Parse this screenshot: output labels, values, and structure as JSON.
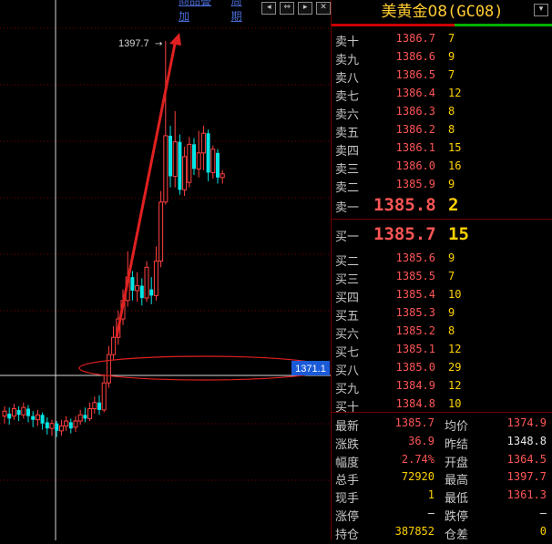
{
  "toolbar": {
    "overlay": "商品叠加",
    "period": "周期"
  },
  "chart": {
    "peak_label": "1397.7",
    "price_tag": "1371.1",
    "candles": [
      {
        "o": 1367.2,
        "c": 1367.6,
        "h": 1368.0,
        "l": 1366.6
      },
      {
        "o": 1367.4,
        "c": 1367.0,
        "h": 1367.9,
        "l": 1366.5
      },
      {
        "o": 1367.2,
        "c": 1367.8,
        "h": 1368.2,
        "l": 1366.9
      },
      {
        "o": 1367.7,
        "c": 1367.3,
        "h": 1368.0,
        "l": 1366.8
      },
      {
        "o": 1367.3,
        "c": 1367.9,
        "h": 1368.3,
        "l": 1367.0
      },
      {
        "o": 1367.8,
        "c": 1367.2,
        "h": 1368.1,
        "l": 1366.7
      },
      {
        "o": 1367.2,
        "c": 1366.9,
        "h": 1367.6,
        "l": 1366.3
      },
      {
        "o": 1366.9,
        "c": 1367.3,
        "h": 1367.7,
        "l": 1366.4
      },
      {
        "o": 1367.3,
        "c": 1366.6,
        "h": 1367.5,
        "l": 1366.1
      },
      {
        "o": 1366.7,
        "c": 1366.2,
        "h": 1367.1,
        "l": 1365.7
      },
      {
        "o": 1366.2,
        "c": 1366.6,
        "h": 1366.9,
        "l": 1365.6
      },
      {
        "o": 1366.6,
        "c": 1366.0,
        "h": 1366.8,
        "l": 1365.5
      },
      {
        "o": 1366.0,
        "c": 1366.4,
        "h": 1366.9,
        "l": 1365.6
      },
      {
        "o": 1366.4,
        "c": 1366.8,
        "h": 1367.2,
        "l": 1366.0
      },
      {
        "o": 1366.7,
        "c": 1366.2,
        "h": 1367.0,
        "l": 1365.8
      },
      {
        "o": 1366.3,
        "c": 1366.8,
        "h": 1367.2,
        "l": 1365.9
      },
      {
        "o": 1366.8,
        "c": 1367.3,
        "h": 1367.7,
        "l": 1366.5
      },
      {
        "o": 1367.3,
        "c": 1367.0,
        "h": 1367.9,
        "l": 1366.7
      },
      {
        "o": 1367.0,
        "c": 1367.8,
        "h": 1368.3,
        "l": 1366.8
      },
      {
        "o": 1367.8,
        "c": 1368.3,
        "h": 1368.8,
        "l": 1367.4
      },
      {
        "o": 1368.3,
        "c": 1367.7,
        "h": 1368.9,
        "l": 1367.3
      },
      {
        "o": 1367.7,
        "c": 1369.9,
        "h": 1370.6,
        "l": 1367.5
      },
      {
        "o": 1369.9,
        "c": 1372.2,
        "h": 1372.9,
        "l": 1369.5
      },
      {
        "o": 1372.2,
        "c": 1373.6,
        "h": 1374.5,
        "l": 1371.8
      },
      {
        "o": 1373.6,
        "c": 1375.1,
        "h": 1375.8,
        "l": 1373.0
      },
      {
        "o": 1375.1,
        "c": 1376.6,
        "h": 1377.5,
        "l": 1374.6
      },
      {
        "o": 1376.6,
        "c": 1378.5,
        "h": 1380.6,
        "l": 1376.1
      },
      {
        "o": 1378.5,
        "c": 1377.4,
        "h": 1379.0,
        "l": 1376.6
      },
      {
        "o": 1377.4,
        "c": 1377.8,
        "h": 1378.9,
        "l": 1376.5
      },
      {
        "o": 1377.8,
        "c": 1376.8,
        "h": 1378.4,
        "l": 1376.2
      },
      {
        "o": 1376.8,
        "c": 1379.3,
        "h": 1379.8,
        "l": 1376.5
      },
      {
        "o": 1377.5,
        "c": 1377.0,
        "h": 1378.5,
        "l": 1376.3
      },
      {
        "o": 1377.0,
        "c": 1379.8,
        "h": 1381.0,
        "l": 1376.6
      },
      {
        "o": 1379.8,
        "c": 1384.6,
        "h": 1385.5,
        "l": 1379.3
      },
      {
        "o": 1384.6,
        "c": 1390.0,
        "h": 1397.7,
        "l": 1384.4
      },
      {
        "o": 1390.0,
        "c": 1386.7,
        "h": 1390.8,
        "l": 1385.8
      },
      {
        "o": 1386.7,
        "c": 1389.5,
        "h": 1392.0,
        "l": 1385.8
      },
      {
        "o": 1389.5,
        "c": 1385.6,
        "h": 1390.1,
        "l": 1385.2
      },
      {
        "o": 1385.6,
        "c": 1388.3,
        "h": 1389.1,
        "l": 1385.1
      },
      {
        "o": 1386.2,
        "c": 1389.3,
        "h": 1389.9,
        "l": 1385.8
      },
      {
        "o": 1389.3,
        "c": 1387.3,
        "h": 1389.8,
        "l": 1386.8
      },
      {
        "o": 1387.3,
        "c": 1388.6,
        "h": 1390.4,
        "l": 1386.6
      },
      {
        "o": 1388.6,
        "c": 1390.2,
        "h": 1390.8,
        "l": 1387.2
      },
      {
        "o": 1390.2,
        "c": 1387.0,
        "h": 1390.5,
        "l": 1386.3
      },
      {
        "o": 1387.0,
        "c": 1388.9,
        "h": 1389.2,
        "l": 1386.5
      },
      {
        "o": 1388.6,
        "c": 1386.6,
        "h": 1388.9,
        "l": 1386.1
      },
      {
        "o": 1386.6,
        "c": 1386.9,
        "h": 1387.2,
        "l": 1386.1
      }
    ]
  },
  "panel": {
    "title": "美黄金08",
    "code": "(GC08)",
    "sell": [
      {
        "label": "卖十",
        "price": "1386.7",
        "vol": "7"
      },
      {
        "label": "卖九",
        "price": "1386.6",
        "vol": "9"
      },
      {
        "label": "卖八",
        "price": "1386.5",
        "vol": "7"
      },
      {
        "label": "卖七",
        "price": "1386.4",
        "vol": "12"
      },
      {
        "label": "卖六",
        "price": "1386.3",
        "vol": "8"
      },
      {
        "label": "卖五",
        "price": "1386.2",
        "vol": "8"
      },
      {
        "label": "卖四",
        "price": "1386.1",
        "vol": "15"
      },
      {
        "label": "卖三",
        "price": "1386.0",
        "vol": "16"
      },
      {
        "label": "卖二",
        "price": "1385.9",
        "vol": "9"
      },
      {
        "label": "卖一",
        "price": "1385.8",
        "vol": "2"
      }
    ],
    "buy": [
      {
        "label": "买一",
        "price": "1385.7",
        "vol": "15"
      },
      {
        "label": "买二",
        "price": "1385.6",
        "vol": "9"
      },
      {
        "label": "买三",
        "price": "1385.5",
        "vol": "7"
      },
      {
        "label": "买四",
        "price": "1385.4",
        "vol": "10"
      },
      {
        "label": "买五",
        "price": "1385.3",
        "vol": "9"
      },
      {
        "label": "买六",
        "price": "1385.2",
        "vol": "8"
      },
      {
        "label": "买七",
        "price": "1385.1",
        "vol": "12"
      },
      {
        "label": "买八",
        "price": "1385.0",
        "vol": "29"
      },
      {
        "label": "买九",
        "price": "1384.9",
        "vol": "12"
      },
      {
        "label": "买十",
        "price": "1384.8",
        "vol": "10"
      }
    ],
    "stats": [
      {
        "l": "最新",
        "lv": "1385.7",
        "lc": "red",
        "r": "均价",
        "rv": "1374.9",
        "rc": "red"
      },
      {
        "l": "涨跌",
        "lv": "36.9",
        "lc": "red",
        "r": "昨结",
        "rv": "1348.8",
        "rc": "white"
      },
      {
        "l": "幅度",
        "lv": "2.74%",
        "lc": "red",
        "r": "开盘",
        "rv": "1364.5",
        "rc": "red"
      },
      {
        "l": "总手",
        "lv": "72920",
        "lc": "yellow",
        "r": "最高",
        "rv": "1397.7",
        "rc": "red"
      },
      {
        "l": "现手",
        "lv": "1",
        "lc": "yellow",
        "r": "最低",
        "rv": "1361.3",
        "rc": "red"
      },
      {
        "l": "涨停",
        "lv": "—",
        "lc": "white",
        "r": "跌停",
        "rv": "—",
        "rc": "white"
      },
      {
        "l": "持仓",
        "lv": "387852",
        "lc": "yellow",
        "r": "仓差",
        "rv": "0",
        "rc": "yellow"
      }
    ]
  }
}
